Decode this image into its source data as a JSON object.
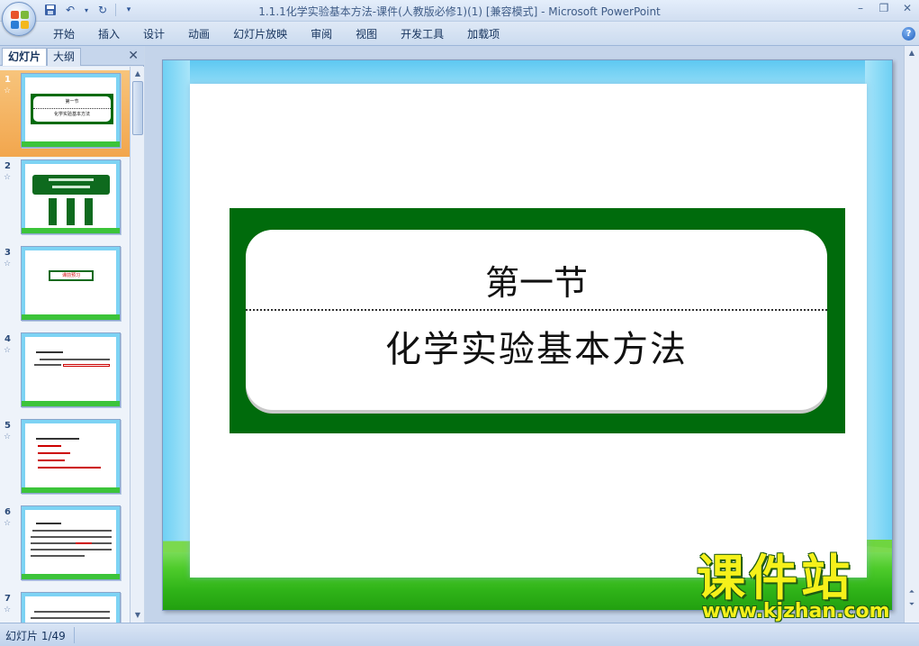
{
  "window": {
    "title": "1.1.1化学实验基本方法-课件(人教版必修1)(1) [兼容模式]",
    "title_sep": " - ",
    "app_name": "Microsoft PowerPoint"
  },
  "ribbon": {
    "tabs": [
      "开始",
      "插入",
      "设计",
      "动画",
      "幻灯片放映",
      "审阅",
      "视图",
      "开发工具",
      "加载项"
    ],
    "help": "?"
  },
  "left_pane": {
    "tab_slides": "幻灯片",
    "tab_outline": "大纲",
    "close": "✕",
    "slide_numbers": [
      "1",
      "2",
      "3",
      "4",
      "5",
      "6",
      "7"
    ],
    "star": "☆",
    "thumb_texts": {
      "s1_l1": "第一节",
      "s1_l2": "化学实验基本方法",
      "s3": "课前预习"
    }
  },
  "slide": {
    "line1": "第一节",
    "line2": "化学实验基本方法"
  },
  "watermark": {
    "cn": "课件站",
    "url": "www.kjzhan.com"
  },
  "status": {
    "slide_info": "幻灯片 1/49"
  },
  "colors": {
    "title_box_green": "#006b0c",
    "sky_blue": "#6ed0f4",
    "grass_green": "#3cc43a",
    "selected_thumb": "#f2a64d",
    "watermark_yellow": "#f6f11a"
  }
}
